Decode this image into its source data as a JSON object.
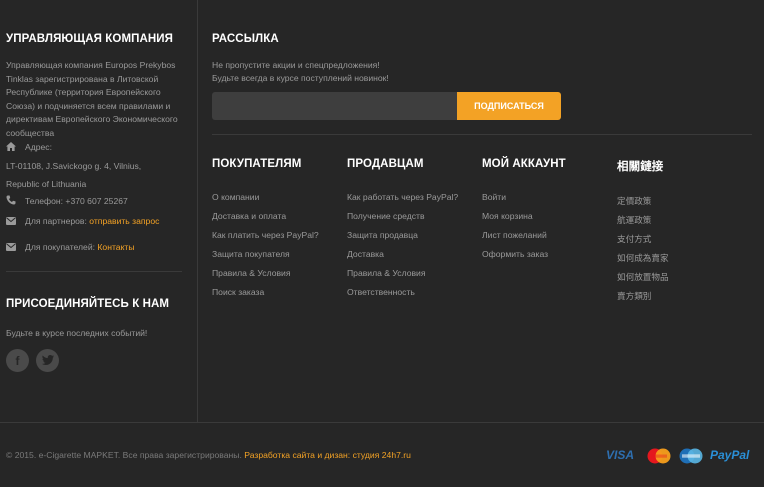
{
  "company": {
    "heading": "УПРАВЛЯЮЩАЯ КОМПАНИЯ",
    "description": "Управляющая компания Europos Prekybos Tinklas зарегистрирована в Литовской Республике (территория Европейского Союза) и подчиняется всем правилами и директивам Европейского Экономического сообщества",
    "address_label": "Адрес:",
    "address_line1": "LT-01108, J.Savickogo g. 4, Vilnius,",
    "address_line2": "Republic of Lithuania",
    "phone": "Телефон: +370 607 25267",
    "partners_label": "Для партнеров:",
    "partners_link": "отправить запрос",
    "buyers_label": "Для покупателей:",
    "buyers_link": "Контакты"
  },
  "join": {
    "heading": "ПРИСОЕДИНЯЙТЕСЬ К НАМ",
    "text": "Будьте в курсе последних событий!",
    "social": [
      {
        "icon": "facebook-icon",
        "glyph": "f"
      },
      {
        "icon": "twitter-icon",
        "glyph": "t"
      }
    ]
  },
  "newsletter": {
    "heading": "РАССЫЛКА",
    "line1": "Не пропустите акции и спецпредложения!",
    "line2": "Будьте всегда в курсе поступлений новинок!",
    "input_value": "",
    "input_placeholder": "",
    "button_label": "ПОДПИСАТЬСЯ"
  },
  "menus": [
    {
      "heading": "ПОКУПАТЕЛЯМ",
      "items": [
        "О компании",
        "Доставка и оплата",
        "Как платить через PayPal?",
        "Защита покупателя",
        "Правила & Условия",
        "Поиск заказа"
      ]
    },
    {
      "heading": "ПРОДАВЦАМ",
      "items": [
        "Как работать через PayPal?",
        "Получение средств",
        "Защита продавца",
        "Доставка",
        "Правила & Условия",
        "Ответственность"
      ]
    },
    {
      "heading": "МОЙ АККАУНТ",
      "items": [
        "Войти",
        "Моя корзина",
        "Лист пожеланий",
        "Оформить заказ"
      ]
    },
    {
      "heading": "相關鏈接",
      "items": [
        "定價政策",
        "航運政策",
        "支付方式",
        "如何成為賣家",
        "如何放置物品",
        "賣方類別"
      ]
    }
  ],
  "footer": {
    "copyright": "© 2015. e-Cigarette MAPKET. Все права зарегистрированы.",
    "credit": "Разработка сайта и дизан: студия 24h7.ru",
    "payments": {
      "visa": "VISA",
      "mastercard": "MasterCard",
      "cirrus": "Cirrus",
      "paypal": "PayPal"
    }
  },
  "colors": {
    "background": "#262626",
    "accent": "#f3a225",
    "heading": "#ffffff",
    "text": "#9a9a9a"
  }
}
